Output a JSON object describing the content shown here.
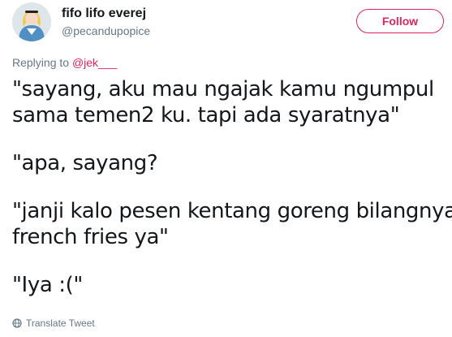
{
  "author": {
    "display_name": "fifo lifo everej",
    "handle": "@pecandupopice",
    "avatar_icon": "profile-photo"
  },
  "follow": {
    "label": "Follow"
  },
  "reply_context": {
    "prefix": "Replying to",
    "mention": "@jek___"
  },
  "tweet": {
    "paragraphs": [
      [
        "\"sayang, aku mau ngajak kamu ngumpul",
        "sama temen2 ku. tapi ada syaratnya\""
      ],
      [
        "\"apa, sayang?"
      ],
      [
        "\"janji kalo pesen kentang goreng bilangnya",
        "french fries ya\""
      ],
      [
        "\"Iya :(\""
      ]
    ]
  },
  "translate": {
    "label": "Translate Tweet",
    "icon": "globe-icon"
  },
  "colors": {
    "accent": "#e0245e",
    "text": "#14171a",
    "secondary_text": "#657786"
  }
}
